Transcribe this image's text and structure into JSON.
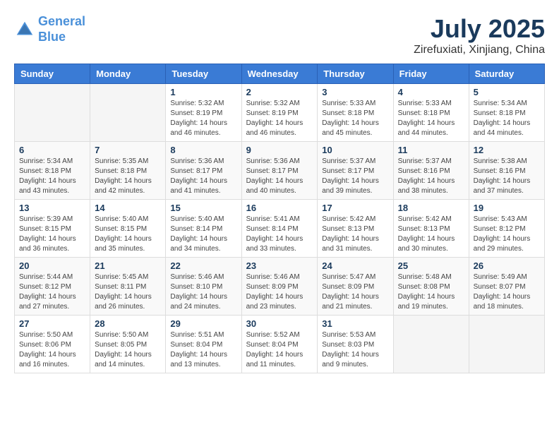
{
  "header": {
    "logo_line1": "General",
    "logo_line2": "Blue",
    "month": "July 2025",
    "location": "Zirefuxiati, Xinjiang, China"
  },
  "days_of_week": [
    "Sunday",
    "Monday",
    "Tuesday",
    "Wednesday",
    "Thursday",
    "Friday",
    "Saturday"
  ],
  "weeks": [
    [
      {
        "day": "",
        "content": ""
      },
      {
        "day": "",
        "content": ""
      },
      {
        "day": "1",
        "content": "Sunrise: 5:32 AM\nSunset: 8:19 PM\nDaylight: 14 hours\nand 46 minutes."
      },
      {
        "day": "2",
        "content": "Sunrise: 5:32 AM\nSunset: 8:19 PM\nDaylight: 14 hours\nand 46 minutes."
      },
      {
        "day": "3",
        "content": "Sunrise: 5:33 AM\nSunset: 8:18 PM\nDaylight: 14 hours\nand 45 minutes."
      },
      {
        "day": "4",
        "content": "Sunrise: 5:33 AM\nSunset: 8:18 PM\nDaylight: 14 hours\nand 44 minutes."
      },
      {
        "day": "5",
        "content": "Sunrise: 5:34 AM\nSunset: 8:18 PM\nDaylight: 14 hours\nand 44 minutes."
      }
    ],
    [
      {
        "day": "6",
        "content": "Sunrise: 5:34 AM\nSunset: 8:18 PM\nDaylight: 14 hours\nand 43 minutes."
      },
      {
        "day": "7",
        "content": "Sunrise: 5:35 AM\nSunset: 8:18 PM\nDaylight: 14 hours\nand 42 minutes."
      },
      {
        "day": "8",
        "content": "Sunrise: 5:36 AM\nSunset: 8:17 PM\nDaylight: 14 hours\nand 41 minutes."
      },
      {
        "day": "9",
        "content": "Sunrise: 5:36 AM\nSunset: 8:17 PM\nDaylight: 14 hours\nand 40 minutes."
      },
      {
        "day": "10",
        "content": "Sunrise: 5:37 AM\nSunset: 8:17 PM\nDaylight: 14 hours\nand 39 minutes."
      },
      {
        "day": "11",
        "content": "Sunrise: 5:37 AM\nSunset: 8:16 PM\nDaylight: 14 hours\nand 38 minutes."
      },
      {
        "day": "12",
        "content": "Sunrise: 5:38 AM\nSunset: 8:16 PM\nDaylight: 14 hours\nand 37 minutes."
      }
    ],
    [
      {
        "day": "13",
        "content": "Sunrise: 5:39 AM\nSunset: 8:15 PM\nDaylight: 14 hours\nand 36 minutes."
      },
      {
        "day": "14",
        "content": "Sunrise: 5:40 AM\nSunset: 8:15 PM\nDaylight: 14 hours\nand 35 minutes."
      },
      {
        "day": "15",
        "content": "Sunrise: 5:40 AM\nSunset: 8:14 PM\nDaylight: 14 hours\nand 34 minutes."
      },
      {
        "day": "16",
        "content": "Sunrise: 5:41 AM\nSunset: 8:14 PM\nDaylight: 14 hours\nand 33 minutes."
      },
      {
        "day": "17",
        "content": "Sunrise: 5:42 AM\nSunset: 8:13 PM\nDaylight: 14 hours\nand 31 minutes."
      },
      {
        "day": "18",
        "content": "Sunrise: 5:42 AM\nSunset: 8:13 PM\nDaylight: 14 hours\nand 30 minutes."
      },
      {
        "day": "19",
        "content": "Sunrise: 5:43 AM\nSunset: 8:12 PM\nDaylight: 14 hours\nand 29 minutes."
      }
    ],
    [
      {
        "day": "20",
        "content": "Sunrise: 5:44 AM\nSunset: 8:12 PM\nDaylight: 14 hours\nand 27 minutes."
      },
      {
        "day": "21",
        "content": "Sunrise: 5:45 AM\nSunset: 8:11 PM\nDaylight: 14 hours\nand 26 minutes."
      },
      {
        "day": "22",
        "content": "Sunrise: 5:46 AM\nSunset: 8:10 PM\nDaylight: 14 hours\nand 24 minutes."
      },
      {
        "day": "23",
        "content": "Sunrise: 5:46 AM\nSunset: 8:09 PM\nDaylight: 14 hours\nand 23 minutes."
      },
      {
        "day": "24",
        "content": "Sunrise: 5:47 AM\nSunset: 8:09 PM\nDaylight: 14 hours\nand 21 minutes."
      },
      {
        "day": "25",
        "content": "Sunrise: 5:48 AM\nSunset: 8:08 PM\nDaylight: 14 hours\nand 19 minutes."
      },
      {
        "day": "26",
        "content": "Sunrise: 5:49 AM\nSunset: 8:07 PM\nDaylight: 14 hours\nand 18 minutes."
      }
    ],
    [
      {
        "day": "27",
        "content": "Sunrise: 5:50 AM\nSunset: 8:06 PM\nDaylight: 14 hours\nand 16 minutes."
      },
      {
        "day": "28",
        "content": "Sunrise: 5:50 AM\nSunset: 8:05 PM\nDaylight: 14 hours\nand 14 minutes."
      },
      {
        "day": "29",
        "content": "Sunrise: 5:51 AM\nSunset: 8:04 PM\nDaylight: 14 hours\nand 13 minutes."
      },
      {
        "day": "30",
        "content": "Sunrise: 5:52 AM\nSunset: 8:04 PM\nDaylight: 14 hours\nand 11 minutes."
      },
      {
        "day": "31",
        "content": "Sunrise: 5:53 AM\nSunset: 8:03 PM\nDaylight: 14 hours\nand 9 minutes."
      },
      {
        "day": "",
        "content": ""
      },
      {
        "day": "",
        "content": ""
      }
    ]
  ]
}
